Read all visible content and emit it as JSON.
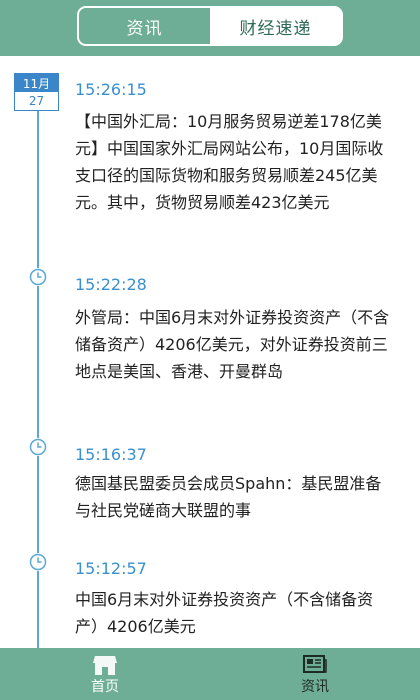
{
  "tabs": {
    "active_label": "资讯",
    "inactive_label": "财经速递"
  },
  "date_badge": {
    "month": "11月",
    "day": "27"
  },
  "items": [
    {
      "time": "15:26:15",
      "text": "【中国外汇局：10月服务贸易逆差178亿美元】中国国家外汇局网站公布，10月国际收支口径的国际货物和服务贸易顺差245亿美元。其中，货物贸易顺差423亿美元"
    },
    {
      "time": "15:22:28",
      "text": "外管局：中国6月末对外证券投资资产（不含储备资产）4206亿美元，对外证券投资前三地点是美国、香港、开曼群岛"
    },
    {
      "time": "15:16:37",
      "text": "德国基民盟委员会成员Spahn：基民盟准备与社民党磋商大联盟的事"
    },
    {
      "time": "15:12:57",
      "text": "中国6月末对外证券投资资产（不含储备资产）4206亿美元"
    }
  ],
  "bottom_nav": {
    "home_label": "首页",
    "news_label": "资讯"
  },
  "colors": {
    "header": "#6fae96",
    "time_text": "#3a8fd0",
    "timeline": "#5aa8d6"
  },
  "icons": {
    "clock": "clock-icon",
    "home": "home-icon",
    "news": "news-icon"
  }
}
